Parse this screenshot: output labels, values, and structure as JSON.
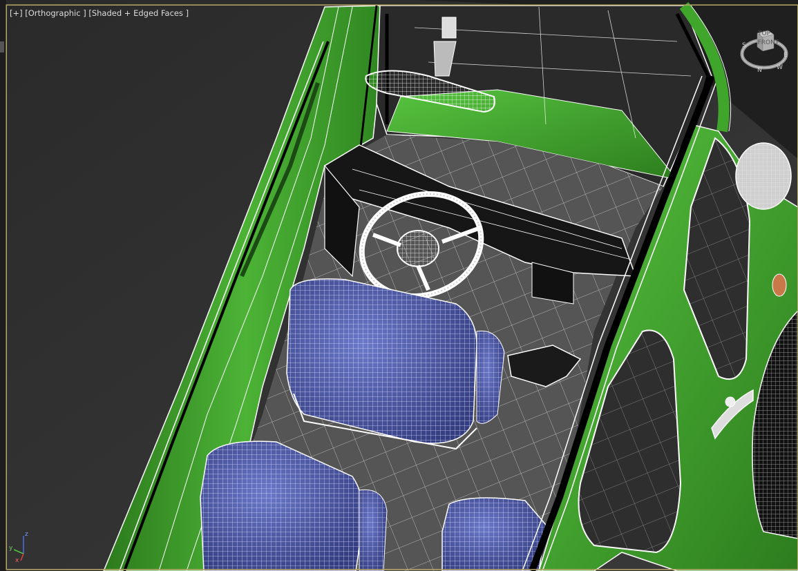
{
  "viewport": {
    "menu_plus": "[+]",
    "view_mode": "[Orthographic ]",
    "shading_mode": "[Shaded + Edged Faces ]"
  },
  "viewcube": {
    "top_face": "TOP",
    "front_face": "FRONT",
    "compass_labels": [
      "S",
      "E",
      "N",
      "W"
    ]
  },
  "axis_tripod": {
    "x": "x",
    "y": "y",
    "z": "z"
  },
  "colors": {
    "background": "#2b2b2b",
    "body_green": "#3f9e2a",
    "seat_blue": "#4a55a0",
    "wire": "#ffffff",
    "frame": "#b8a868"
  }
}
